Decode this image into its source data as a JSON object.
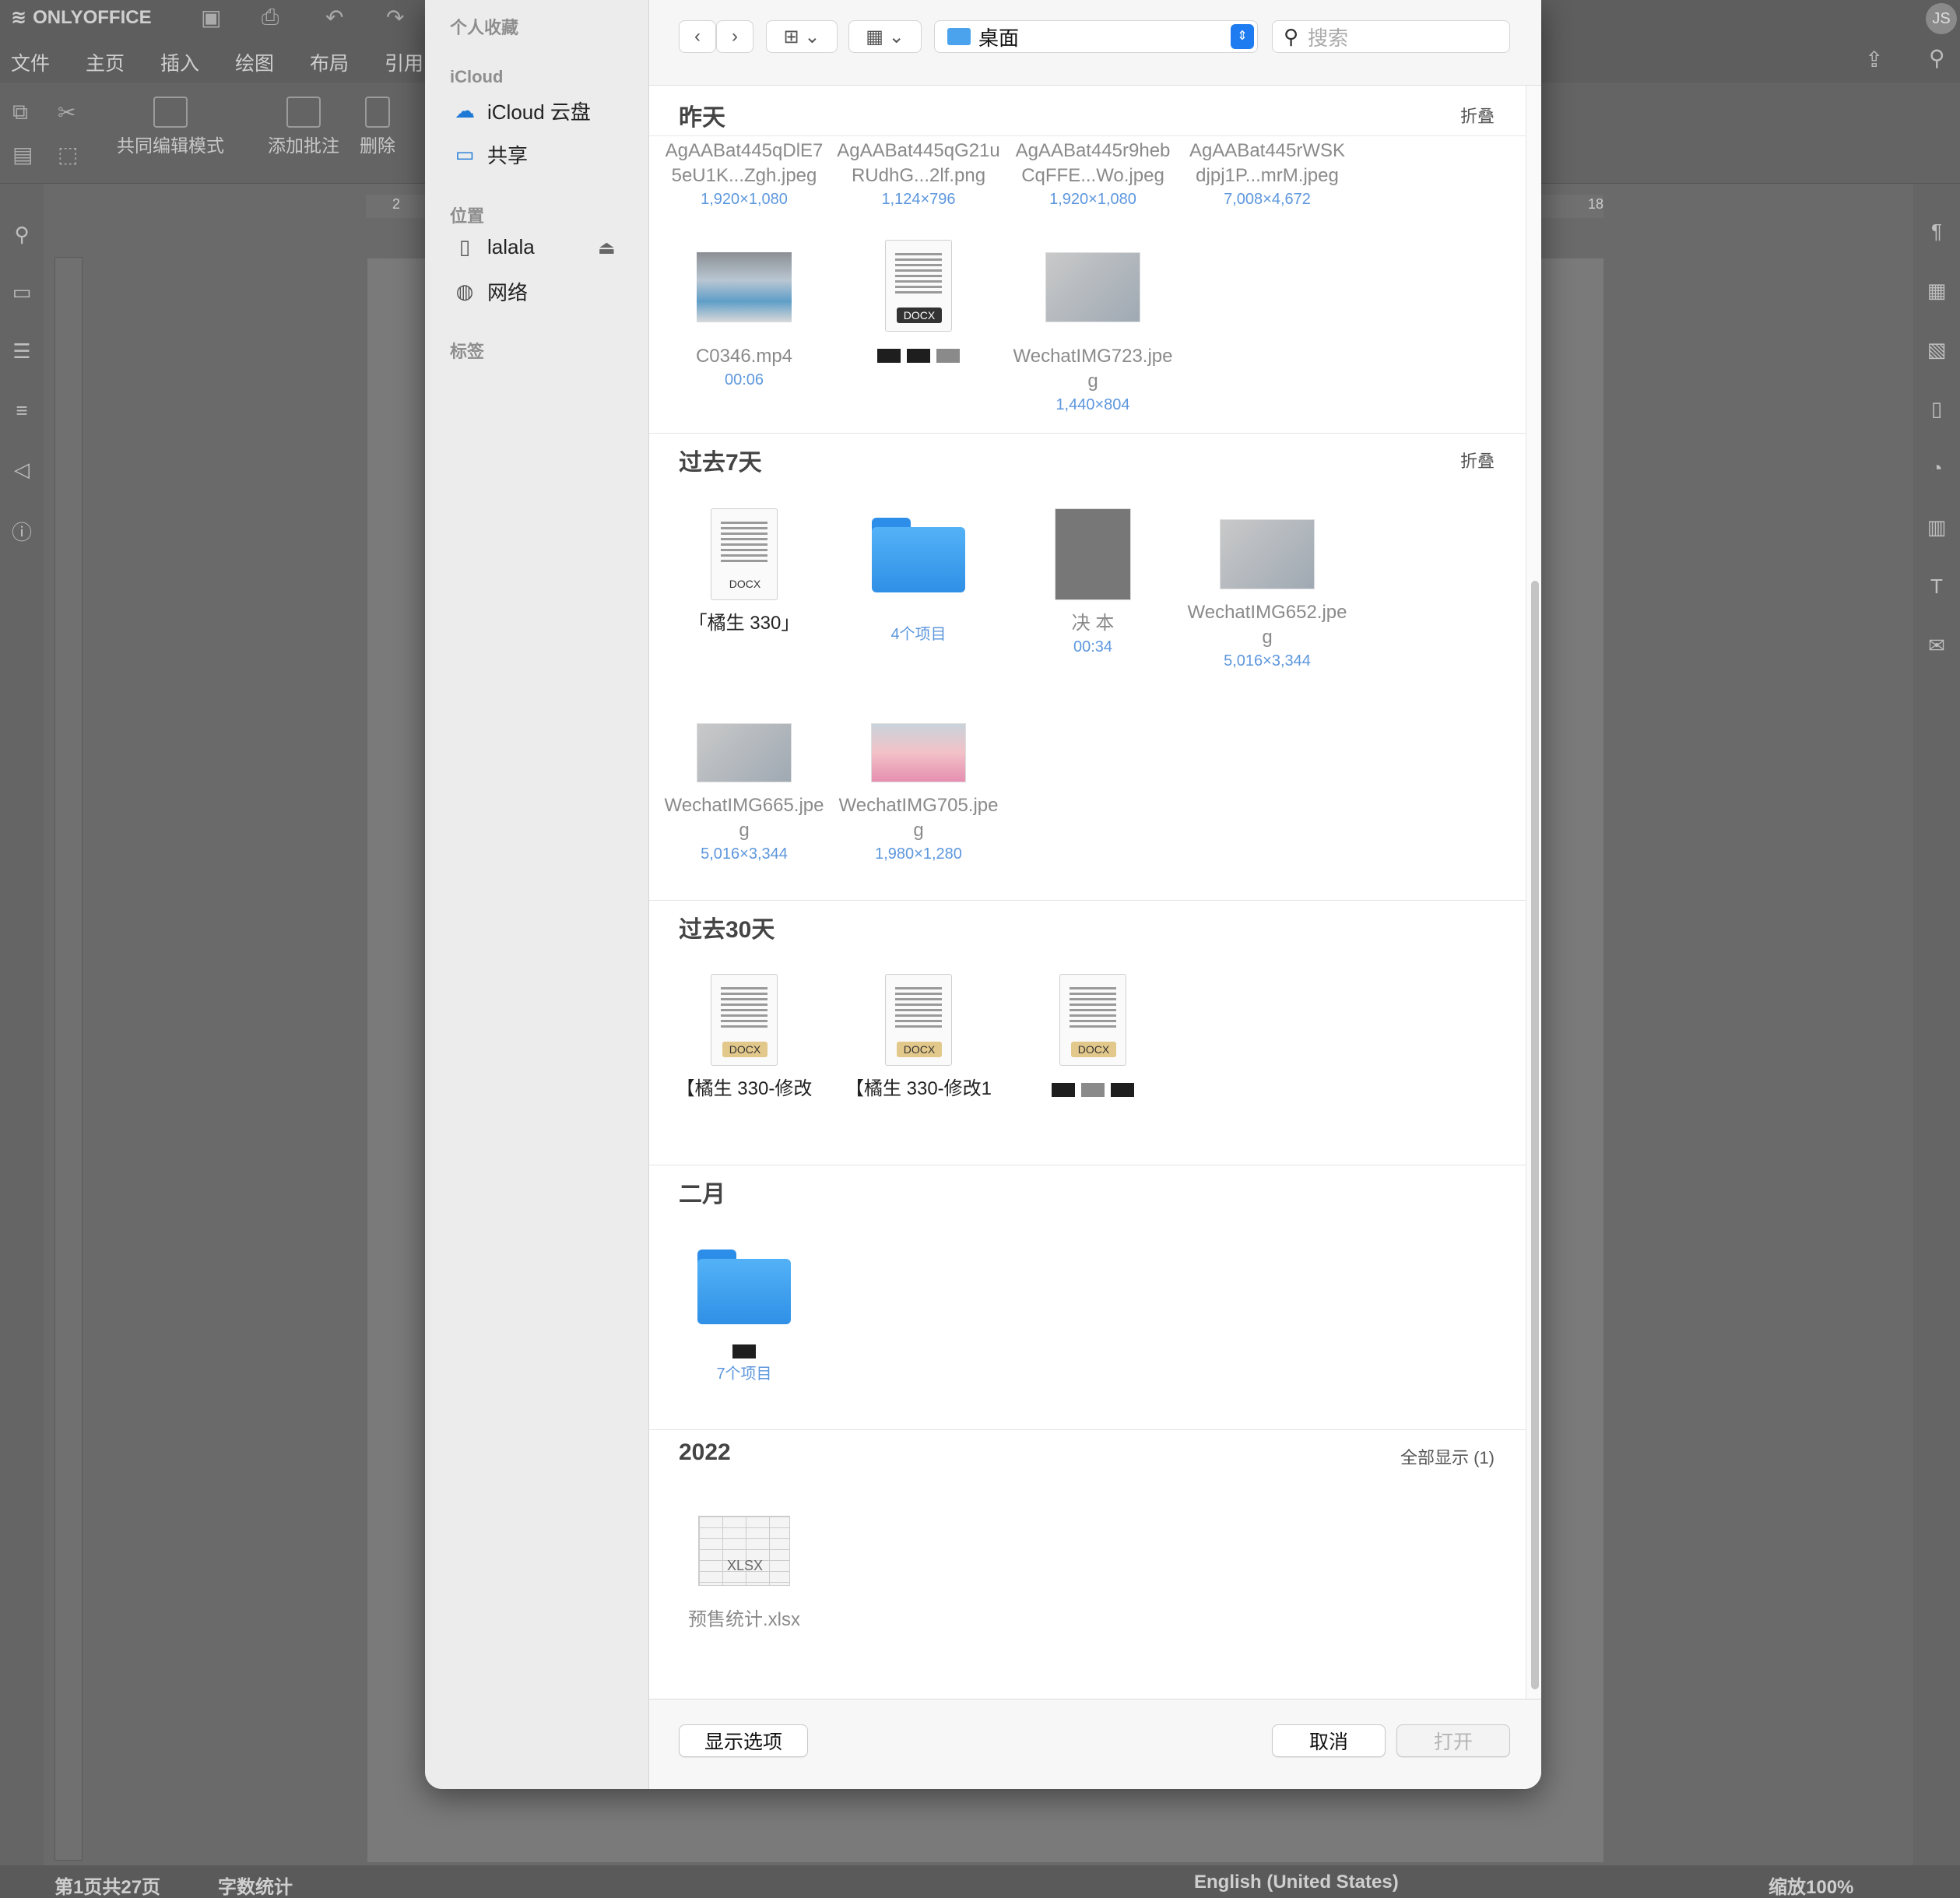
{
  "app": {
    "brand": "ONLYOFFICE",
    "user_initials": "JS"
  },
  "menu": [
    "文件",
    "主页",
    "插入",
    "绘图",
    "布局",
    "引用"
  ],
  "toolbar": {
    "coedit": "共同编辑模式",
    "add_comment": "添加批注",
    "delete": "删除"
  },
  "hruler": {
    "left": "2",
    "right": "18"
  },
  "status": {
    "page": "第1页共27页",
    "wordcount": "字数统计",
    "language": "English (United States)",
    "zoom": "缩放100%"
  },
  "dialog": {
    "sidebar": {
      "favorites": "个人收藏",
      "icloud_header": "iCloud",
      "icloud_drive": "iCloud 云盘",
      "shared": "共享",
      "locations_header": "位置",
      "lalala": "lalala",
      "network": "网络",
      "tags_header": "标签"
    },
    "location": "桌面",
    "search_placeholder": "搜索",
    "sections": {
      "yesterday": {
        "title": "昨天",
        "action": "折叠"
      },
      "last7": {
        "title": "过去7天",
        "action": "折叠"
      },
      "last30": {
        "title": "过去30天"
      },
      "feb": {
        "title": "二月"
      },
      "y2022": {
        "title": "2022",
        "action": "全部显示 (1)"
      }
    },
    "items": {
      "y1": {
        "name": "AgAABat445qDlE75eU1K...Zgh.jpeg",
        "meta": "1,920×1,080"
      },
      "y2": {
        "name": "AgAABat445qG21uRUdhG...2lf.png",
        "meta": "1,124×796"
      },
      "y3": {
        "name": "AgAABat445r9hebCqFFE...Wo.jpeg",
        "meta": "1,920×1,080"
      },
      "y4": {
        "name": "AgAABat445rWSKdjpj1P...mrM.jpeg",
        "meta": "7,008×4,672"
      },
      "y5": {
        "name": "C0346.mp4",
        "meta": "00:06"
      },
      "y6": {
        "name": "",
        "meta": "",
        "tag": "DOCX"
      },
      "y7": {
        "name": "WechatIMG723.jpeg",
        "meta": "1,440×804"
      },
      "w1": {
        "name": "「橘生 330」",
        "tag": "DOCX"
      },
      "w2": {
        "meta": "4个项目"
      },
      "w3": {
        "name": "决 本",
        "meta": "00:34"
      },
      "w4": {
        "name": "WechatIMG652.jpeg",
        "meta": "5,016×3,344"
      },
      "w5": {
        "name": "WechatIMG665.jpeg",
        "meta": "5,016×3,344"
      },
      "w6": {
        "name": "WechatIMG705.jpeg",
        "meta": "1,980×1,280"
      },
      "m1": {
        "name": "【橘生 330-修改",
        "tag": "DOCX"
      },
      "m2": {
        "name": "【橘生 330-修改1",
        "tag": "DOCX"
      },
      "m3": {
        "name": "",
        "tag": "DOCX"
      },
      "f1": {
        "meta": "7个项目"
      },
      "x1": {
        "name": "预售统计.xlsx",
        "tag": "XLSX"
      }
    },
    "buttons": {
      "options": "显示选项",
      "cancel": "取消",
      "open": "打开"
    }
  },
  "colors": {
    "accent": "#1f7cf0",
    "meta_blue": "#5d97dd",
    "folder": "#3b9ff0"
  }
}
